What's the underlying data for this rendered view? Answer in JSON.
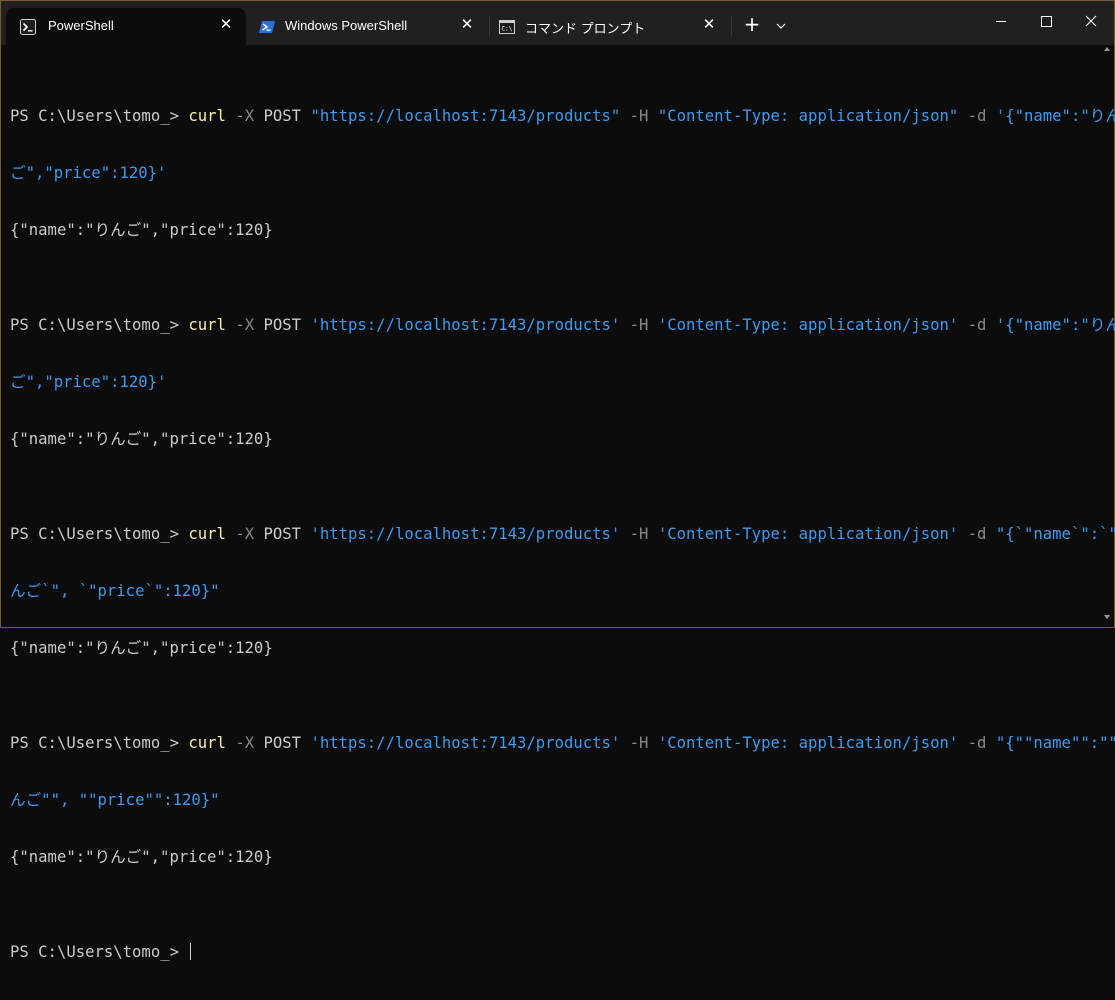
{
  "tabs": [
    {
      "label": "PowerShell",
      "icon": "terminal-icon",
      "active": true
    },
    {
      "label": "Windows PowerShell",
      "icon": "powershell-icon",
      "active": false
    },
    {
      "label": "コマンド プロンプト",
      "icon": "cmd-icon",
      "active": false
    }
  ],
  "titlebar": {
    "new_tab": "+",
    "dropdown": "⌄",
    "minimize": "—",
    "maximize": "☐",
    "close": "✕"
  },
  "colors": {
    "accent_border": "#7a5a2e",
    "command": "#f9f1a5",
    "string": "#3b9bef",
    "parameter": "#8a8a8a",
    "text": "#cccccc",
    "background": "#0c0c0c"
  },
  "terminal": {
    "prompt": "PS C:\\Users\\tomo_> ",
    "commands": [
      {
        "cmd": "curl",
        "flag_x": " -X ",
        "method": "POST ",
        "url": "\"https://localhost:7143/products\"",
        "flag_h": " -H ",
        "header": "\"Content-Type: application/json\"",
        "flag_d": " -d ",
        "body_line1": "'{\"name\":\"りん",
        "body_line2": "ご\",\"price\":120}'",
        "output": "{\"name\":\"りんご\",\"price\":120}"
      },
      {
        "cmd": "curl",
        "flag_x": " -X ",
        "method": "POST ",
        "url": "'https://localhost:7143/products'",
        "flag_h": " -H ",
        "header": "'Content-Type: application/json'",
        "flag_d": " -d ",
        "body_line1": "'{\"name\":\"りん",
        "body_line2": "ご\",\"price\":120}'",
        "output": "{\"name\":\"りんご\",\"price\":120}"
      },
      {
        "cmd": "curl",
        "flag_x": " -X ",
        "method": "POST ",
        "url": "'https://localhost:7143/products'",
        "flag_h": " -H ",
        "header": "'Content-Type: application/json'",
        "flag_d": " -d ",
        "body_line1": "\"{`\"name`\":`\"り",
        "body_line2": "んご`\", `\"price`\":120}\"",
        "output": "{\"name\":\"りんご\",\"price\":120}"
      },
      {
        "cmd": "curl",
        "flag_x": " -X ",
        "method": "POST ",
        "url": "'https://localhost:7143/products'",
        "flag_h": " -H ",
        "header": "'Content-Type: application/json'",
        "flag_d": " -d ",
        "body_line1": "\"{\"\"name\"\":\"\"り",
        "body_line2": "んご\"\", \"\"price\"\":120}\"",
        "output": "{\"name\":\"りんご\",\"price\":120}"
      }
    ],
    "final_prompt": "PS C:\\Users\\tomo_> "
  }
}
